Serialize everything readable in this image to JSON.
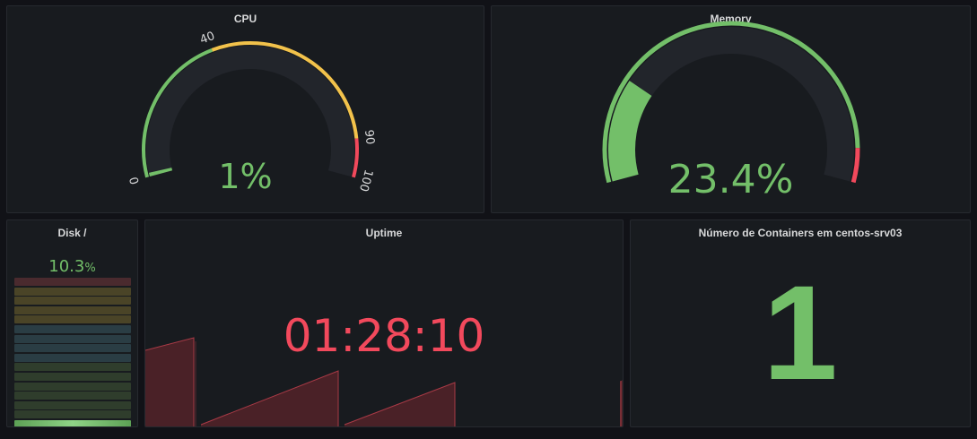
{
  "cpu": {
    "title": "CPU",
    "value_text": "1%",
    "value": 1,
    "min": 0,
    "max": 100,
    "thresholds": [
      {
        "label": "0",
        "value": 0
      },
      {
        "label": "40",
        "value": 40
      },
      {
        "label": "90",
        "value": 90
      },
      {
        "label": "100",
        "value": 100
      }
    ]
  },
  "memory": {
    "title": "Memory",
    "value_text": "23.4%",
    "value": 23.4
  },
  "disk": {
    "title": "Disk /",
    "value_number": "10.3",
    "value_unit": "%",
    "value": 10.3
  },
  "uptime": {
    "title": "Uptime",
    "value_text": "01:28:10"
  },
  "containers": {
    "title": "Número de Containers em centos-srv03",
    "value_text": "1"
  },
  "colors": {
    "green": "#73bf69",
    "yellow": "#fade2a",
    "orange": "#f2cc0c",
    "red": "#f2495c",
    "panel_bg": "#181b1f",
    "page_bg": "#111217"
  }
}
